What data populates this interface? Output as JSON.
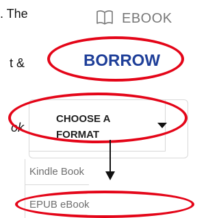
{
  "text_fragments": [
    ". The",
    "t &",
    "ok"
  ],
  "ebook": {
    "icon": "open-book-icon",
    "label": "EBOOK"
  },
  "borrow": {
    "label": "BORROW"
  },
  "format": {
    "label": "CHOOSE A FORMAT",
    "options": [
      "Kindle Book",
      "EPUB eBook"
    ]
  },
  "colors": {
    "annotation": "#e40518",
    "borrow_text": "#1f3f99",
    "muted": "#777777"
  }
}
